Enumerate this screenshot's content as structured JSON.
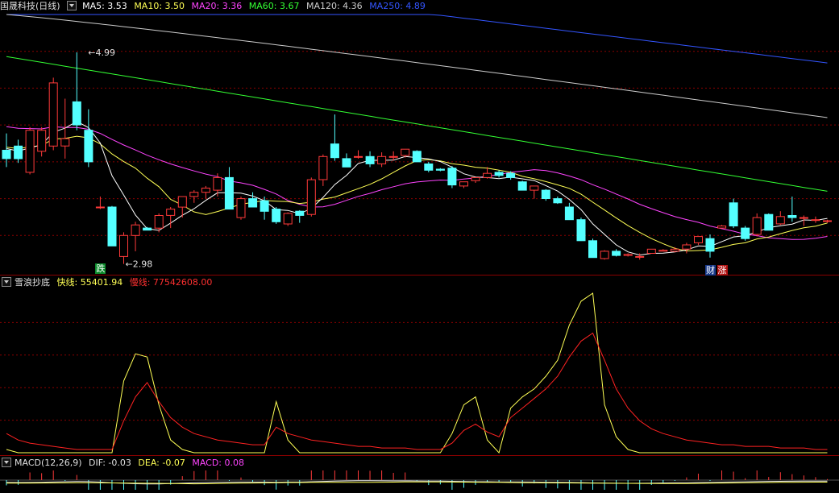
{
  "header": {
    "stock_name": "国晟科技",
    "period": "(日线)",
    "ma": [
      {
        "label": "MA5: 3.53",
        "color": "#ffffff"
      },
      {
        "label": "MA10: 3.50",
        "color": "#ffff55"
      },
      {
        "label": "MA20: 3.36",
        "color": "#ff44ff"
      },
      {
        "label": "MA60: 3.67",
        "color": "#33ff33"
      },
      {
        "label": "MA120: 4.36",
        "color": "#cccccc"
      },
      {
        "label": "MA250: 4.89",
        "color": "#3355ff"
      }
    ]
  },
  "indicator1": {
    "name": "雪浪抄底",
    "fast_label": "快线: 55401.94",
    "slow_label": "慢线: 77542608.00"
  },
  "indicator2": {
    "name": "MACD(12,26,9)",
    "dif_label": "DIF: -0.03",
    "dea_label": "DEA: -0.07",
    "macd_label": "MACD: 0.08"
  },
  "annotations": {
    "high_label": "4.99",
    "low_label": "2.98",
    "signal_die": "跌",
    "signal_cai": "财",
    "signal_zhang": "涨"
  },
  "colors": {
    "up": "#ff3a3a",
    "down": "#54ffff",
    "ma5": "#ffffff",
    "ma10": "#ffff55",
    "ma20": "#ff44ff",
    "ma60": "#33ff33",
    "ma120": "#cccccc",
    "ma250": "#3355ff",
    "fast": "#ffff55",
    "slow": "#ff2222",
    "grid": "#8a0000"
  },
  "chart_data": [
    {
      "type": "candlestick",
      "title": "国晟科技 (日线)",
      "ylim": [
        2.9,
        5.35
      ],
      "ohlc": [
        [
          4.06,
          4.22,
          3.9,
          3.98
        ],
        [
          4.1,
          4.16,
          3.94,
          3.98
        ],
        [
          3.85,
          4.28,
          3.83,
          4.25
        ],
        [
          4.05,
          4.28,
          4.0,
          4.25
        ],
        [
          4.1,
          4.75,
          4.06,
          4.7
        ],
        [
          4.1,
          4.55,
          3.98,
          4.17
        ],
        [
          4.52,
          4.99,
          4.25,
          4.3
        ],
        [
          4.25,
          4.45,
          3.9,
          3.95
        ],
        [
          3.52,
          3.62,
          3.5,
          3.52
        ],
        [
          3.52,
          3.53,
          3.15,
          3.15
        ],
        [
          3.05,
          3.28,
          2.98,
          3.25
        ],
        [
          3.25,
          3.38,
          3.1,
          3.35
        ],
        [
          3.32,
          3.33,
          3.3,
          3.3
        ],
        [
          3.32,
          3.46,
          3.28,
          3.44
        ],
        [
          3.44,
          3.52,
          3.32,
          3.5
        ],
        [
          3.52,
          3.62,
          3.42,
          3.62
        ],
        [
          3.62,
          3.68,
          3.56,
          3.66
        ],
        [
          3.66,
          3.72,
          3.6,
          3.7
        ],
        [
          3.68,
          3.84,
          3.62,
          3.8
        ],
        [
          3.8,
          3.9,
          3.5,
          3.5
        ],
        [
          3.42,
          3.62,
          3.4,
          3.6
        ],
        [
          3.6,
          3.66,
          3.52,
          3.52
        ],
        [
          3.58,
          3.62,
          3.4,
          3.48
        ],
        [
          3.5,
          3.52,
          3.36,
          3.38
        ],
        [
          3.36,
          3.47,
          3.34,
          3.46
        ],
        [
          3.48,
          3.49,
          3.37,
          3.44
        ],
        [
          3.45,
          3.8,
          3.43,
          3.78
        ],
        [
          3.78,
          4.02,
          3.72,
          4.0
        ],
        [
          4.12,
          4.4,
          3.96,
          3.99
        ],
        [
          3.98,
          4.03,
          3.9,
          3.9
        ],
        [
          4.0,
          4.06,
          3.98,
          4.0
        ],
        [
          4.0,
          4.05,
          3.9,
          3.93
        ],
        [
          3.93,
          4.04,
          3.9,
          4.0
        ],
        [
          4.0,
          4.05,
          3.96,
          4.0
        ],
        [
          4.01,
          4.07,
          3.99,
          4.07
        ],
        [
          4.05,
          4.06,
          3.95,
          3.95
        ],
        [
          3.93,
          3.95,
          3.85,
          3.87
        ],
        [
          3.88,
          3.89,
          3.86,
          3.87
        ],
        [
          3.89,
          3.91,
          3.7,
          3.73
        ],
        [
          3.72,
          3.76,
          3.7,
          3.76
        ],
        [
          3.77,
          3.8,
          3.75,
          3.8
        ],
        [
          3.8,
          3.9,
          3.79,
          3.84
        ],
        [
          3.85,
          3.87,
          3.8,
          3.82
        ],
        [
          3.84,
          3.86,
          3.78,
          3.8
        ],
        [
          3.76,
          3.77,
          3.68,
          3.68
        ],
        [
          3.68,
          3.72,
          3.6,
          3.72
        ],
        [
          3.68,
          3.69,
          3.58,
          3.6
        ],
        [
          3.6,
          3.62,
          3.55,
          3.56
        ],
        [
          3.52,
          3.56,
          3.4,
          3.4
        ],
        [
          3.4,
          3.42,
          3.2,
          3.2
        ],
        [
          3.2,
          3.22,
          3.04,
          3.04
        ],
        [
          3.03,
          3.11,
          3.02,
          3.1
        ],
        [
          3.1,
          3.12,
          3.05,
          3.06
        ],
        [
          3.06,
          3.08,
          3.05,
          3.07
        ],
        [
          3.05,
          3.08,
          3.02,
          3.05
        ],
        [
          3.08,
          3.12,
          3.08,
          3.12
        ],
        [
          3.1,
          3.12,
          3.1,
          3.11
        ],
        [
          3.1,
          3.14,
          3.09,
          3.12
        ],
        [
          3.12,
          3.18,
          3.08,
          3.16
        ],
        [
          3.18,
          3.24,
          3.16,
          3.24
        ],
        [
          3.22,
          3.26,
          3.04,
          3.1
        ],
        [
          3.32,
          3.35,
          3.32,
          3.34
        ],
        [
          3.56,
          3.6,
          3.32,
          3.34
        ],
        [
          3.32,
          3.34,
          3.2,
          3.22
        ],
        [
          3.26,
          3.46,
          3.24,
          3.42
        ],
        [
          3.45,
          3.46,
          3.3,
          3.3
        ],
        [
          3.36,
          3.48,
          3.35,
          3.43
        ],
        [
          3.44,
          3.62,
          3.38,
          3.42
        ],
        [
          3.42,
          3.44,
          3.34,
          3.42
        ],
        [
          3.4,
          3.43,
          3.37,
          3.4
        ],
        [
          3.39,
          3.4,
          3.37,
          3.39
        ]
      ],
      "annotations": [
        "4.99 (high)",
        "2.98 (low)"
      ]
    },
    {
      "type": "line",
      "title": "雪浪抄底",
      "series": [
        {
          "name": "快线",
          "values": [
            0.02,
            0.0,
            0.0,
            0.0,
            0.0,
            0.0,
            0.0,
            0.0,
            0.0,
            0.0,
            0.45,
            0.62,
            0.6,
            0.3,
            0.08,
            0.02,
            0.0,
            0.0,
            0.0,
            0.0,
            0.0,
            0.0,
            0.0,
            0.32,
            0.08,
            0.0,
            0.0,
            0.0,
            0.0,
            0.0,
            0.0,
            0.0,
            0.0,
            0.0,
            0.0,
            0.0,
            0.0,
            0.0,
            0.12,
            0.3,
            0.35,
            0.08,
            0.0,
            0.28,
            0.35,
            0.4,
            0.48,
            0.58,
            0.8,
            0.95,
            1.0,
            0.3,
            0.1,
            0.02,
            0.0,
            0.0,
            0.0,
            0.0,
            0.0,
            0.0,
            0.0,
            0.0,
            0.0,
            0.0,
            0.0,
            0.0,
            0.0,
            0.0,
            0.0,
            0.0,
            0.0
          ]
        },
        {
          "name": "慢线",
          "values": [
            0.12,
            0.08,
            0.06,
            0.05,
            0.04,
            0.03,
            0.02,
            0.02,
            0.02,
            0.02,
            0.2,
            0.35,
            0.44,
            0.32,
            0.22,
            0.16,
            0.12,
            0.1,
            0.08,
            0.07,
            0.06,
            0.05,
            0.05,
            0.16,
            0.12,
            0.1,
            0.08,
            0.07,
            0.06,
            0.05,
            0.04,
            0.04,
            0.03,
            0.03,
            0.03,
            0.02,
            0.02,
            0.02,
            0.06,
            0.14,
            0.18,
            0.13,
            0.1,
            0.22,
            0.28,
            0.34,
            0.4,
            0.48,
            0.6,
            0.7,
            0.75,
            0.58,
            0.4,
            0.28,
            0.2,
            0.15,
            0.12,
            0.1,
            0.08,
            0.07,
            0.06,
            0.05,
            0.05,
            0.04,
            0.04,
            0.04,
            0.03,
            0.03,
            0.03,
            0.02,
            0.02
          ]
        }
      ]
    },
    {
      "type": "bar",
      "title": "MACD(12,26,9)",
      "series": [
        {
          "name": "DIF",
          "values": [
            -0.03
          ]
        },
        {
          "name": "DEA",
          "values": [
            -0.07
          ]
        },
        {
          "name": "MACD",
          "values": [
            0.08
          ]
        }
      ]
    }
  ]
}
